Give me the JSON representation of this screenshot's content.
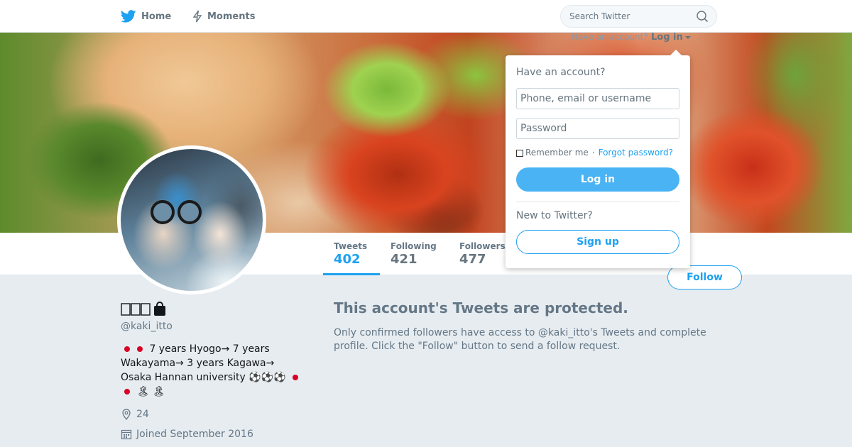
{
  "nav": {
    "home_label": "Home",
    "moments_label": "Moments",
    "search_placeholder": "Search Twitter"
  },
  "login_link": {
    "prompt": "Have an account?",
    "label": "Log in"
  },
  "dropdown": {
    "heading": "Have an account?",
    "username_placeholder": "Phone, email or username",
    "password_placeholder": "Password",
    "remember_label": "Remember me",
    "separator": "·",
    "forgot_label": "Forgot password?",
    "login_button": "Log in",
    "new_prompt": "New to Twitter?",
    "signup_button": "Sign up"
  },
  "stats": {
    "tweets": {
      "label": "Tweets",
      "value": "402"
    },
    "following": {
      "label": "Following",
      "value": "421"
    },
    "followers": {
      "label": "Followers",
      "value": "477"
    }
  },
  "follow_button": "Follow",
  "profile": {
    "screen_name": "@kaki_itto",
    "bio_line1": "7 years Hyogo→ 7 years",
    "bio_line2": "Wakayama→ 3 years Kagawa→",
    "bio_line3": "Osaka Hannan university ⚽⚽⚽",
    "bio_line4": "🏝 🏝",
    "location": "24",
    "joined": "Joined September 2016"
  },
  "protected": {
    "title": "This account's Tweets are protected.",
    "text": "Only confirmed followers have access to @kaki_itto's Tweets and complete profile. Click the \"Follow\" button to send a follow request."
  },
  "colors": {
    "accent": "#1da1f2",
    "login_button": "#4ab3f4",
    "background": "#e6ecf0",
    "muted_text": "#657786"
  },
  "icons": {
    "home": "twitter-bird-icon",
    "moments": "lightning-icon",
    "search": "search-icon",
    "location": "location-pin-icon",
    "joined": "calendar-icon",
    "protected": "lock-icon"
  }
}
